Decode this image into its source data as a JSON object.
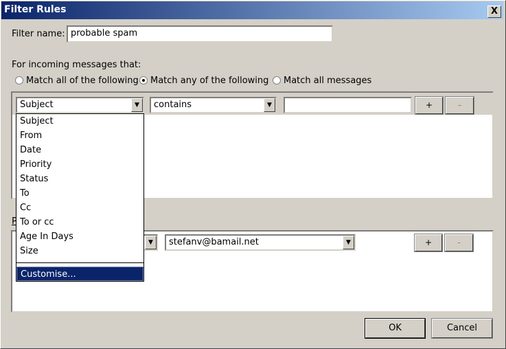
{
  "window": {
    "title": "Filter Rules",
    "close": "X"
  },
  "filter_name": {
    "label": "Filter name:",
    "value": "probable spam"
  },
  "conditions": {
    "heading": "For incoming messages that:",
    "radios": [
      {
        "label": "Match all of the following",
        "checked": false
      },
      {
        "label": "Match any of the following",
        "checked": true
      },
      {
        "label": "Match all messages",
        "checked": false
      }
    ],
    "field": "Subject",
    "operator": "contains",
    "value": "",
    "add": "+",
    "remove": "–"
  },
  "dropdown": {
    "items": [
      "Subject",
      "From",
      "Date",
      "Priority",
      "Status",
      "To",
      "Cc",
      "To or cc",
      "Age In Days",
      "Size"
    ],
    "highlighted": "Customise..."
  },
  "actions": {
    "label_partial": "P",
    "target": "stefanv@bamail.net",
    "add": "+",
    "remove": "-"
  },
  "buttons": {
    "ok": "OK",
    "cancel": "Cancel"
  }
}
